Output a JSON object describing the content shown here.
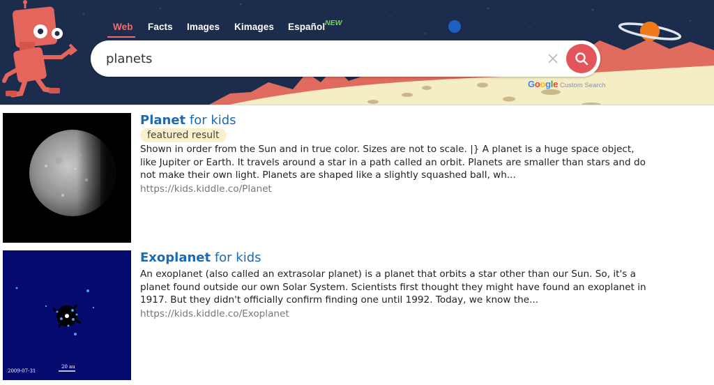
{
  "nav": {
    "items": [
      {
        "label": "Web",
        "active": true
      },
      {
        "label": "Facts",
        "active": false
      },
      {
        "label": "Images",
        "active": false
      },
      {
        "label": "Kimages",
        "active": false
      },
      {
        "label": "Español",
        "active": false
      }
    ],
    "new_badge": "NEW"
  },
  "search": {
    "query": "planets",
    "powered_by": {
      "letters": [
        "G",
        "o",
        "o",
        "g",
        "l",
        "e"
      ],
      "letter_colors": [
        "#4285f4",
        "#ea4335",
        "#fbbc05",
        "#4285f4",
        "#34a853",
        "#ea4335"
      ],
      "suffix": "Custom Search"
    }
  },
  "results": [
    {
      "title_main": "Planet",
      "title_rest": " for kids",
      "badge": "featured result",
      "snippet": "Shown in order from the Sun and in true color. Sizes are not to scale. |} A planet is a huge space object, like Jupiter or Earth. It travels around a star in a path called an orbit. Planets are smaller than stars and do not make their own light. Planets are shaped like a slightly squashed ball, wh...",
      "url": "https://kids.kiddle.co/Planet",
      "image": "planet-photo"
    },
    {
      "title_main": "Exoplanet",
      "title_rest": " for kids",
      "snippet": "An exoplanet (also called an extrasolar planet) is a planet that orbits a star other than our Sun. So, it's a planet found outside our own Solar System. Scientists first thought they might have found an exoplanet in 1917. But they didn't officially confirm finding one until 1992. Today, we know the...",
      "url": "https://kids.kiddle.co/Exoplanet",
      "image": "exoplanet-photo",
      "image_caption_date": "2009-07-31",
      "image_scale_label": "20 au"
    }
  ],
  "colors": {
    "header_bg": "#1c2c4c",
    "accent": "#f06d6d",
    "search_button": "#e4555b",
    "link": "#1c6ab3",
    "url": "#777777",
    "badge_bg": "#fbf0cc",
    "new_badge": "#78d65c"
  }
}
